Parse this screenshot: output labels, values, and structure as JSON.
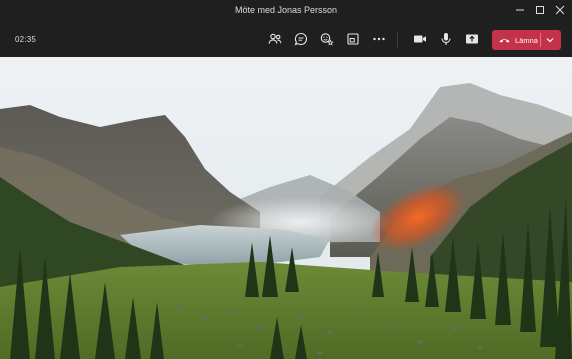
{
  "window": {
    "title": "Möte med Jonas Persson",
    "controls": [
      "minimize-icon",
      "maximize-icon",
      "close-icon"
    ]
  },
  "toolbar": {
    "timer": "02:35",
    "buttons": [
      {
        "name": "participants-button",
        "icon": "people-icon"
      },
      {
        "name": "chat-button",
        "icon": "chat-icon"
      },
      {
        "name": "reactions-button",
        "icon": "reaction-icon"
      },
      {
        "name": "rooms-button",
        "icon": "rooms-icon"
      },
      {
        "name": "more-button",
        "icon": "more-icon"
      },
      {
        "name": "camera-button",
        "icon": "video-camera-icon"
      },
      {
        "name": "mic-button",
        "icon": "microphone-icon"
      },
      {
        "name": "share-button",
        "icon": "share-screen-icon"
      }
    ],
    "leave_label": "Lämna",
    "leave_color": "#c4314b"
  },
  "video": {
    "scene": "mountain-valley-background"
  }
}
